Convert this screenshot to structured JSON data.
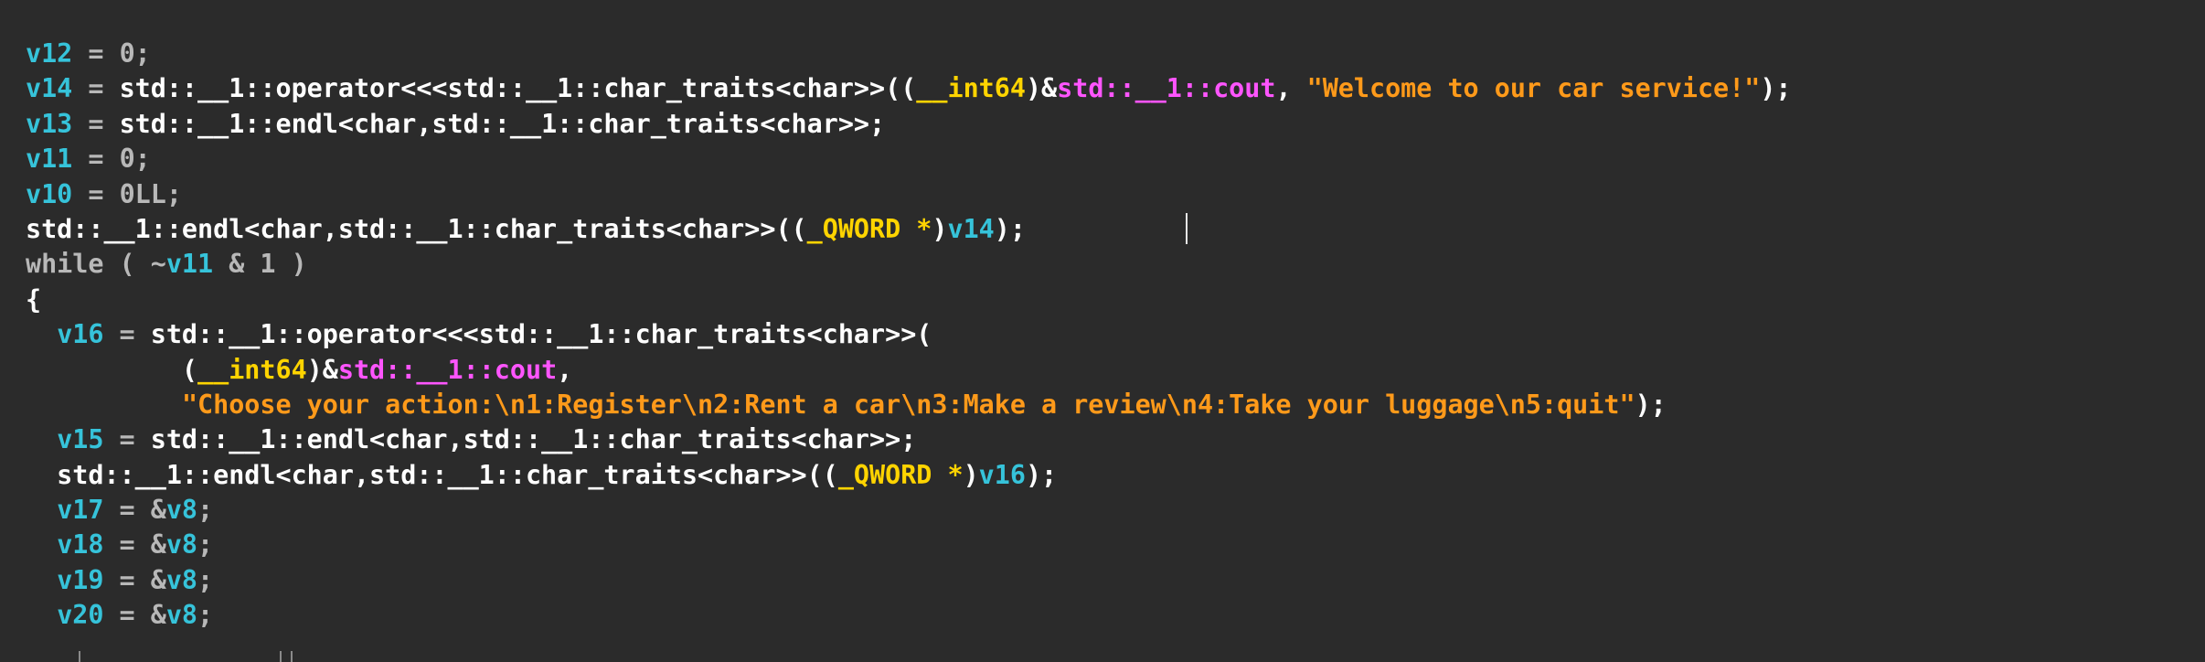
{
  "editor": {
    "caret_line": 6,
    "lines": [
      [
        {
          "t": "v12",
          "c": "var"
        },
        {
          "t": " = ",
          "c": "op"
        },
        {
          "t": "0",
          "c": "num"
        },
        {
          "t": ";",
          "c": "op"
        }
      ],
      [
        {
          "t": "v14",
          "c": "var"
        },
        {
          "t": " = ",
          "c": "op"
        },
        {
          "t": "std::__1::operator<<<std::__1::char_traits<char>>((",
          "c": "plain"
        },
        {
          "t": "__int64",
          "c": "type"
        },
        {
          "t": ")&",
          "c": "plain"
        },
        {
          "t": "std::__1::cout",
          "c": "glob"
        },
        {
          "t": ", ",
          "c": "plain"
        },
        {
          "t": "\"Welcome to our car service!\"",
          "c": "str"
        },
        {
          "t": ");",
          "c": "plain"
        }
      ],
      [
        {
          "t": "v13",
          "c": "var"
        },
        {
          "t": " = ",
          "c": "op"
        },
        {
          "t": "std::__1::endl<char,std::__1::char_traits<char>>;",
          "c": "plain"
        }
      ],
      [
        {
          "t": "v11",
          "c": "var"
        },
        {
          "t": " = ",
          "c": "op"
        },
        {
          "t": "0",
          "c": "num"
        },
        {
          "t": ";",
          "c": "op"
        }
      ],
      [
        {
          "t": "v10",
          "c": "var"
        },
        {
          "t": " = ",
          "c": "op"
        },
        {
          "t": "0LL",
          "c": "num"
        },
        {
          "t": ";",
          "c": "op"
        }
      ],
      [
        {
          "t": "std::__1::endl<char,std::__1::char_traits<char>>((",
          "c": "plain"
        },
        {
          "t": "_QWORD *",
          "c": "type"
        },
        {
          "t": ")",
          "c": "plain"
        },
        {
          "t": "v14",
          "c": "var"
        },
        {
          "t": ");",
          "c": "plain"
        }
      ],
      [
        {
          "t": "while",
          "c": "kw"
        },
        {
          "t": " ( ~",
          "c": "op"
        },
        {
          "t": "v11",
          "c": "var"
        },
        {
          "t": " & 1 )",
          "c": "op"
        }
      ],
      [
        {
          "t": "{",
          "c": "plain"
        }
      ],
      [
        {
          "t": "  ",
          "c": "plain"
        },
        {
          "t": "v16",
          "c": "var"
        },
        {
          "t": " = ",
          "c": "op"
        },
        {
          "t": "std::__1::operator<<<std::__1::char_traits<char>>(",
          "c": "plain"
        }
      ],
      [
        {
          "t": "          (",
          "c": "plain"
        },
        {
          "t": "__int64",
          "c": "type"
        },
        {
          "t": ")&",
          "c": "plain"
        },
        {
          "t": "std::__1::cout",
          "c": "glob"
        },
        {
          "t": ",",
          "c": "plain"
        }
      ],
      [
        {
          "t": "          ",
          "c": "plain"
        },
        {
          "t": "\"Choose your action:\\n1:Register\\n2:Rent a car\\n3:Make a review\\n4:Take your luggage\\n5:quit\"",
          "c": "str"
        },
        {
          "t": ");",
          "c": "plain"
        }
      ],
      [
        {
          "t": "  ",
          "c": "plain"
        },
        {
          "t": "v15",
          "c": "var"
        },
        {
          "t": " = ",
          "c": "op"
        },
        {
          "t": "std::__1::endl<char,std::__1::char_traits<char>>;",
          "c": "plain"
        }
      ],
      [
        {
          "t": "  std::__1::endl<char,std::__1::char_traits<char>>((",
          "c": "plain"
        },
        {
          "t": "_QWORD *",
          "c": "type"
        },
        {
          "t": ")",
          "c": "plain"
        },
        {
          "t": "v16",
          "c": "var"
        },
        {
          "t": ");",
          "c": "plain"
        }
      ],
      [
        {
          "t": "  ",
          "c": "plain"
        },
        {
          "t": "v17",
          "c": "var"
        },
        {
          "t": " = &",
          "c": "op"
        },
        {
          "t": "v8",
          "c": "var"
        },
        {
          "t": ";",
          "c": "op"
        }
      ],
      [
        {
          "t": "  ",
          "c": "plain"
        },
        {
          "t": "v18",
          "c": "var"
        },
        {
          "t": " = &",
          "c": "op"
        },
        {
          "t": "v8",
          "c": "var"
        },
        {
          "t": ";",
          "c": "op"
        }
      ],
      [
        {
          "t": "  ",
          "c": "plain"
        },
        {
          "t": "v19",
          "c": "var"
        },
        {
          "t": " = &",
          "c": "op"
        },
        {
          "t": "v8",
          "c": "var"
        },
        {
          "t": ";",
          "c": "op"
        }
      ],
      [
        {
          "t": "  ",
          "c": "plain"
        },
        {
          "t": "v20",
          "c": "var"
        },
        {
          "t": " = &",
          "c": "op"
        },
        {
          "t": "v8",
          "c": "var"
        },
        {
          "t": ";",
          "c": "op"
        }
      ]
    ]
  }
}
